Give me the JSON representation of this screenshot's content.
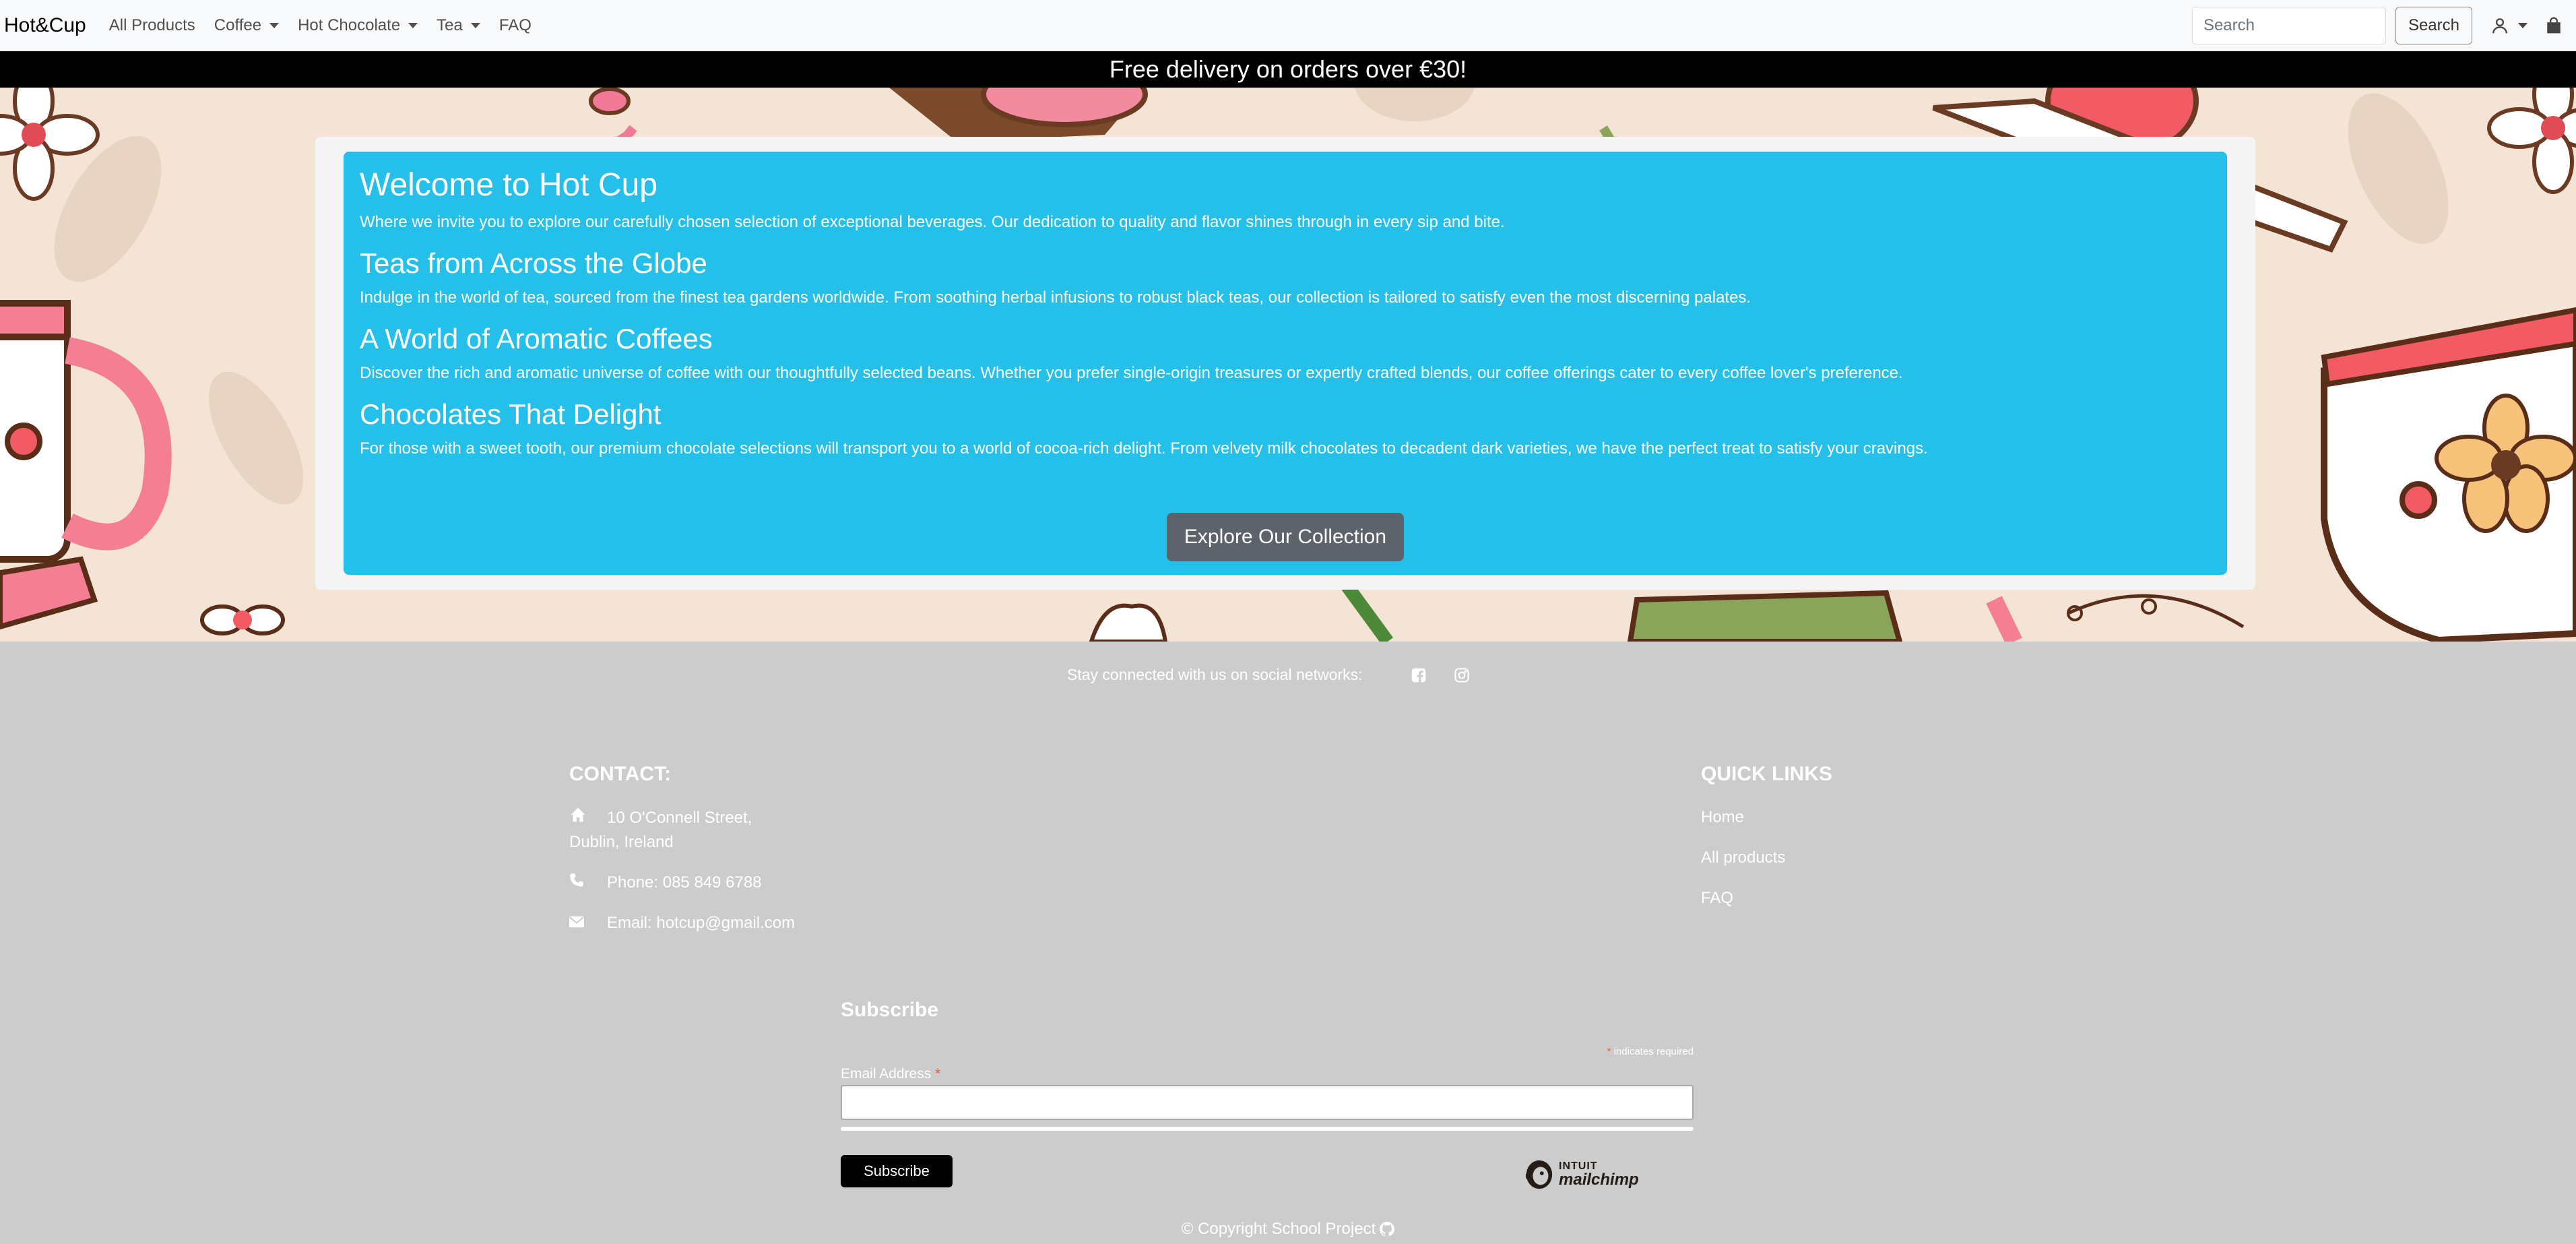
{
  "navbar": {
    "brand": "Hot&Cup",
    "links": [
      {
        "label": "All Products",
        "dropdown": false
      },
      {
        "label": "Coffee",
        "dropdown": true
      },
      {
        "label": "Hot Chocolate",
        "dropdown": true
      },
      {
        "label": "Tea",
        "dropdown": true
      },
      {
        "label": "FAQ",
        "dropdown": false
      }
    ],
    "search": {
      "placeholder": "Search",
      "button_label": "Search"
    },
    "icons": [
      "person-icon",
      "chevron-down-icon",
      "shopping-bag-icon"
    ]
  },
  "promo": {
    "text": "Free delivery on orders over €30!"
  },
  "hero": {
    "sections": [
      {
        "heading": "Welcome to Hot Cup",
        "text": "Where we invite you to explore our carefully chosen selection of exceptional beverages. Our dedication to quality and flavor shines through in every sip and bite."
      },
      {
        "heading": "Teas from Across the Globe",
        "text": "Indulge in the world of tea, sourced from the finest tea gardens worldwide. From soothing herbal infusions to robust black teas, our collection is tailored to satisfy even the most discerning palates."
      },
      {
        "heading": "A World of Aromatic Coffees",
        "text": "Discover the rich and aromatic universe of coffee with our thoughtfully selected beans. Whether you prefer single-origin treasures or expertly crafted blends, our coffee offerings cater to every coffee lover's preference."
      },
      {
        "heading": "Chocolates That Delight",
        "text": "For those with a sweet tooth, our premium chocolate selections will transport you to a world of cocoa-rich delight. From velvety milk chocolates to decadent dark varieties, we have the perfect treat to satisfy your cravings."
      }
    ],
    "cta_label": "Explore Our Collection",
    "colors": {
      "panel": "#25c0ea",
      "button": "#5c636a"
    }
  },
  "footer": {
    "social_text": "Stay connected with us on social networks:",
    "social_icons": [
      "facebook-icon",
      "instagram-icon"
    ],
    "contact": {
      "title": "CONTACT:",
      "address_line1": "10 O'Connell Street,",
      "address_line2": "Dublin, Ireland",
      "phone": "Phone: 085 849 6788",
      "email": "Email: hotcup@gmail.com"
    },
    "quick_links": {
      "title": "QUICK LINKS",
      "items": [
        "Home",
        "All products",
        "FAQ"
      ]
    },
    "subscribe": {
      "title": "Subscribe",
      "required_star": "*",
      "required_note": "indicates required",
      "email_label": "Email Address",
      "button_label": "Subscribe",
      "badge_top": "INTUIT",
      "badge_bottom": "mailchimp"
    },
    "copyright": "© Copyright School Project"
  }
}
